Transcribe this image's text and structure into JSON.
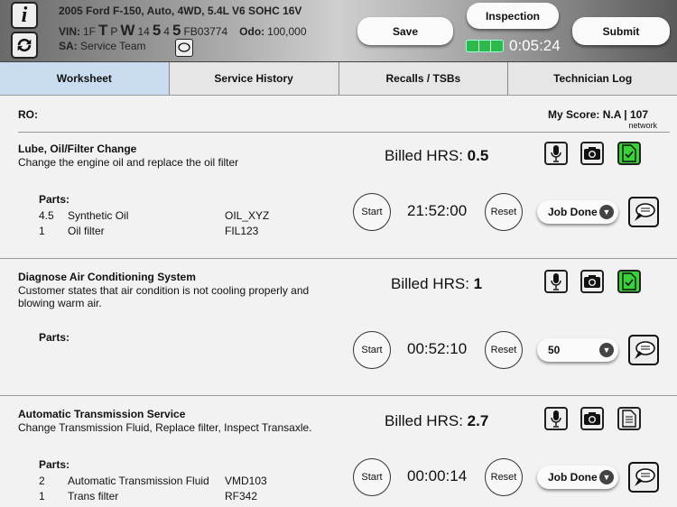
{
  "header": {
    "vehicle": "2005 Ford F-150, Auto, 4WD, 5.4L V6 SOHC 16V",
    "vin_label": "VIN:",
    "vin_parts": [
      "1F",
      "T",
      "P",
      "W",
      "14",
      "5",
      "4",
      "5",
      "FB03774"
    ],
    "odo_label": "Odo:",
    "odo": "100,000",
    "sa_label": "SA:",
    "sa": "Service Team",
    "save": "Save",
    "inspection": "Inspection",
    "submit": "Submit",
    "timer": "0:05:24",
    "battery_color": "#2db84a"
  },
  "tabs": [
    {
      "label": "Worksheet",
      "active": true
    },
    {
      "label": "Service History"
    },
    {
      "label": "Recalls / TSBs"
    },
    {
      "label": "Technician Log"
    }
  ],
  "ro_label": "RO:",
  "score": "My Score: N.A | 107",
  "score_sub": "network",
  "jobs": [
    {
      "title": "Lube, Oil/Filter Change",
      "desc": "Change the engine oil and replace the oil filter",
      "billed_label": "Billed HRS:",
      "billed": "0.5",
      "parts_label": "Parts:",
      "parts": [
        {
          "qty": "4.5",
          "name": "Synthetic Oil",
          "code": "OIL_XYZ"
        },
        {
          "qty": "1",
          "name": "Oil filter",
          "code": "FIL123"
        }
      ],
      "start": "Start",
      "time": "21:52:00",
      "reset": "Reset",
      "status": "Job Done",
      "doc_done": true
    },
    {
      "title": "Diagnose Air Conditioning System",
      "desc": "Customer states that air condition is not cooling properly and blowing warm air.",
      "billed_label": "Billed HRS:",
      "billed": "1",
      "parts_label": "Parts:",
      "parts": [],
      "start": "Start",
      "time": "00:52:10",
      "reset": "Reset",
      "status": "50",
      "doc_done": true
    },
    {
      "title": "Automatic Transmission Service",
      "desc": "Change Transmission Fluid, Replace filter, Inspect Transaxle.",
      "billed_label": "Billed HRS:",
      "billed": "2.7",
      "parts_label": "Parts:",
      "parts": [
        {
          "qty": "2",
          "name": "Automatic Transmission Fluid",
          "code": "VMD103"
        },
        {
          "qty": "1",
          "name": "Trans filter",
          "code": "RF342"
        }
      ],
      "start": "Start",
      "time": "00:00:14",
      "reset": "Reset",
      "status": "Job Done",
      "doc_done": false
    }
  ]
}
